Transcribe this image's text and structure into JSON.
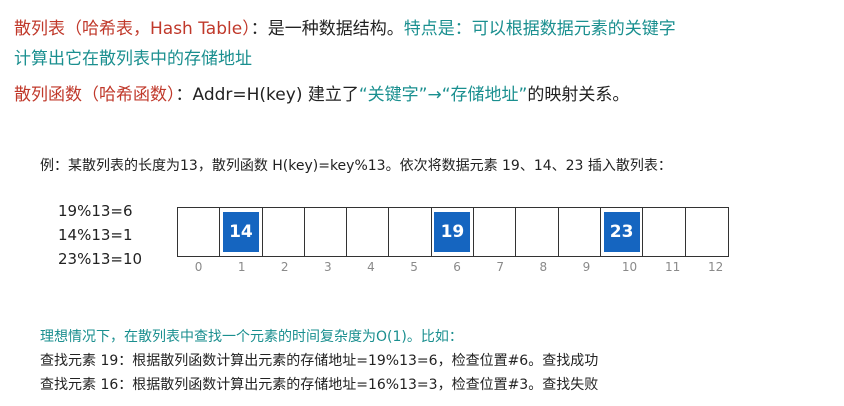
{
  "lines": {
    "l1a": "散列表（哈希表，Hash Table）",
    "l1b": "：是一种数据结构。",
    "l1c": "特点是：可以根据数据元素的关键字",
    "l2": "计算出它在散列表中的存储地址",
    "l3a": "散列函数（哈希函数）",
    "l3b": "：Addr=H(key) 建立了",
    "l3c": "“关键字”→“存储地址”",
    "l3d": "的映射关系。",
    "example": "例：某散列表的长度为13，散列函数 H(key)=key%13。依次将数据元素 19、14、23 插入散列表：",
    "ideal": "理想情况下，在散列表中查找一个元素的时间复杂度为O(1)。比如：",
    "find19": "查找元素 19：根据散列函数计算出元素的存储地址=19%13=6，检查位置#6。查找成功",
    "find16": "查找元素 16：根据散列函数计算出元素的存储地址=16%13=3，检查位置#3。查找失败"
  },
  "equations": [
    "19%13=6",
    "14%13=1",
    "23%13=10"
  ],
  "table": {
    "cells": [
      "",
      "14",
      "",
      "",
      "",
      "",
      "19",
      "",
      "",
      "",
      "23",
      "",
      ""
    ],
    "indices": [
      "0",
      "1",
      "2",
      "3",
      "4",
      "5",
      "6",
      "7",
      "8",
      "9",
      "10",
      "11",
      "12"
    ]
  },
  "colors": {
    "heading": "#c0392b",
    "highlight": "#1a8f8f",
    "cell_fill": "#1565c0"
  }
}
